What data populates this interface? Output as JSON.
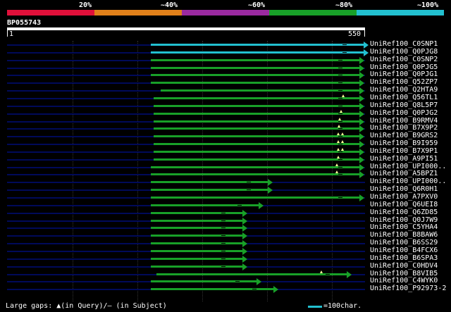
{
  "scale": {
    "labels": [
      "20%",
      "~40%",
      "~60%",
      "~80%",
      "~100%"
    ],
    "colors": [
      "#e0103a",
      "#e0801a",
      "#9a2aa0",
      "#18a028",
      "#22c0d0"
    ]
  },
  "query": {
    "name": "BP055743",
    "start": "1",
    "end": "550"
  },
  "hits": [
    {
      "label": "UniRef100_C0SNP1",
      "start": 214,
      "end": 516,
      "color": "#22c0d0",
      "ins": []
    },
    {
      "label": "UniRef100_Q0PJG8",
      "start": 214,
      "end": 516,
      "color": "#22c0d0",
      "ins": []
    },
    {
      "label": "UniRef100_C0SNP2",
      "start": 214,
      "end": 510,
      "color": "#18a028",
      "ins": []
    },
    {
      "label": "UniRef100_Q0PJG5",
      "start": 214,
      "end": 510,
      "color": "#18a028",
      "ins": []
    },
    {
      "label": "UniRef100_Q0PJG1",
      "start": 214,
      "end": 510,
      "color": "#18a028",
      "ins": []
    },
    {
      "label": "UniRef100_Q52ZP7",
      "start": 214,
      "end": 510,
      "color": "#18a028",
      "ins": []
    },
    {
      "label": "UniRef100_Q2HTA9",
      "start": 228,
      "end": 510,
      "color": "#18a028",
      "ins": []
    },
    {
      "label": "UniRef100_Q56TL1",
      "start": 218,
      "end": 510,
      "color": "#18a028",
      "ins": [
        485
      ]
    },
    {
      "label": "UniRef100_Q8L5P7",
      "start": 218,
      "end": 510,
      "color": "#18a028",
      "ins": []
    },
    {
      "label": "UniRef100_Q0PJG2",
      "start": 218,
      "end": 510,
      "color": "#18a028",
      "ins": [
        482
      ]
    },
    {
      "label": "UniRef100_B9RMV4",
      "start": 218,
      "end": 510,
      "color": "#18a028",
      "ins": [
        480
      ]
    },
    {
      "label": "UniRef100_B7X9P2",
      "start": 218,
      "end": 510,
      "color": "#18a028",
      "ins": [
        479
      ]
    },
    {
      "label": "UniRef100_B9GRS2",
      "start": 218,
      "end": 510,
      "color": "#18a028",
      "ins": [
        478,
        484
      ]
    },
    {
      "label": "UniRef100_B9I959",
      "start": 218,
      "end": 510,
      "color": "#18a028",
      "ins": [
        478,
        484
      ]
    },
    {
      "label": "UniRef100_B7X9P1",
      "start": 218,
      "end": 510,
      "color": "#18a028",
      "ins": [
        478,
        484
      ]
    },
    {
      "label": "UniRef100_A9PI51",
      "start": 218,
      "end": 510,
      "color": "#18a028",
      "ins": [
        478
      ]
    },
    {
      "label": "UniRef100_UPI000..",
      "start": 214,
      "end": 510,
      "color": "#18a028",
      "ins": [
        476
      ]
    },
    {
      "label": "UniRef100_A5BPZ1",
      "start": 214,
      "end": 510,
      "color": "#18a028",
      "ins": [
        476
      ]
    },
    {
      "label": "UniRef100_UPI000..",
      "start": 214,
      "end": 380,
      "color": "#18a028",
      "ins": []
    },
    {
      "label": "UniRef100_Q6R0H1",
      "start": 214,
      "end": 380,
      "color": "#18a028",
      "ins": []
    },
    {
      "label": "UniRef100_A7PXV0",
      "start": 214,
      "end": 510,
      "color": "#18a028",
      "ins": []
    },
    {
      "label": "UniRef100_Q6UEI8",
      "start": 214,
      "end": 367,
      "color": "#18a028",
      "ins": []
    },
    {
      "label": "UniRef100_Q6ZD85",
      "start": 214,
      "end": 344,
      "color": "#18a028",
      "ins": []
    },
    {
      "label": "UniRef100_Q0J7W9",
      "start": 214,
      "end": 344,
      "color": "#18a028",
      "ins": []
    },
    {
      "label": "UniRef100_C5YHA4",
      "start": 214,
      "end": 344,
      "color": "#18a028",
      "ins": []
    },
    {
      "label": "UniRef100_B8BAW6",
      "start": 214,
      "end": 344,
      "color": "#18a028",
      "ins": []
    },
    {
      "label": "UniRef100_B6SS29",
      "start": 214,
      "end": 344,
      "color": "#18a028",
      "ins": []
    },
    {
      "label": "UniRef100_B4FCX6",
      "start": 214,
      "end": 344,
      "color": "#18a028",
      "ins": []
    },
    {
      "label": "UniRef100_B6SPA3",
      "start": 214,
      "end": 344,
      "color": "#18a028",
      "ins": []
    },
    {
      "label": "UniRef100_C0HDV4",
      "start": 214,
      "end": 344,
      "color": "#18a028",
      "ins": []
    },
    {
      "label": "UniRef100_B8VIB5",
      "start": 222,
      "end": 492,
      "color": "#18a028",
      "ins": [
        454
      ]
    },
    {
      "label": "UniRef100_C4WYK0",
      "start": 214,
      "end": 364,
      "color": "#18a028",
      "ins": []
    },
    {
      "label": "UniRef100_P92973-2",
      "start": 214,
      "end": 388,
      "color": "#18a028",
      "ins": []
    }
  ],
  "footer": {
    "text": "Large gaps: ▲(in Query)/– (in Subject)"
  },
  "legend": {
    "label": "=100char."
  }
}
